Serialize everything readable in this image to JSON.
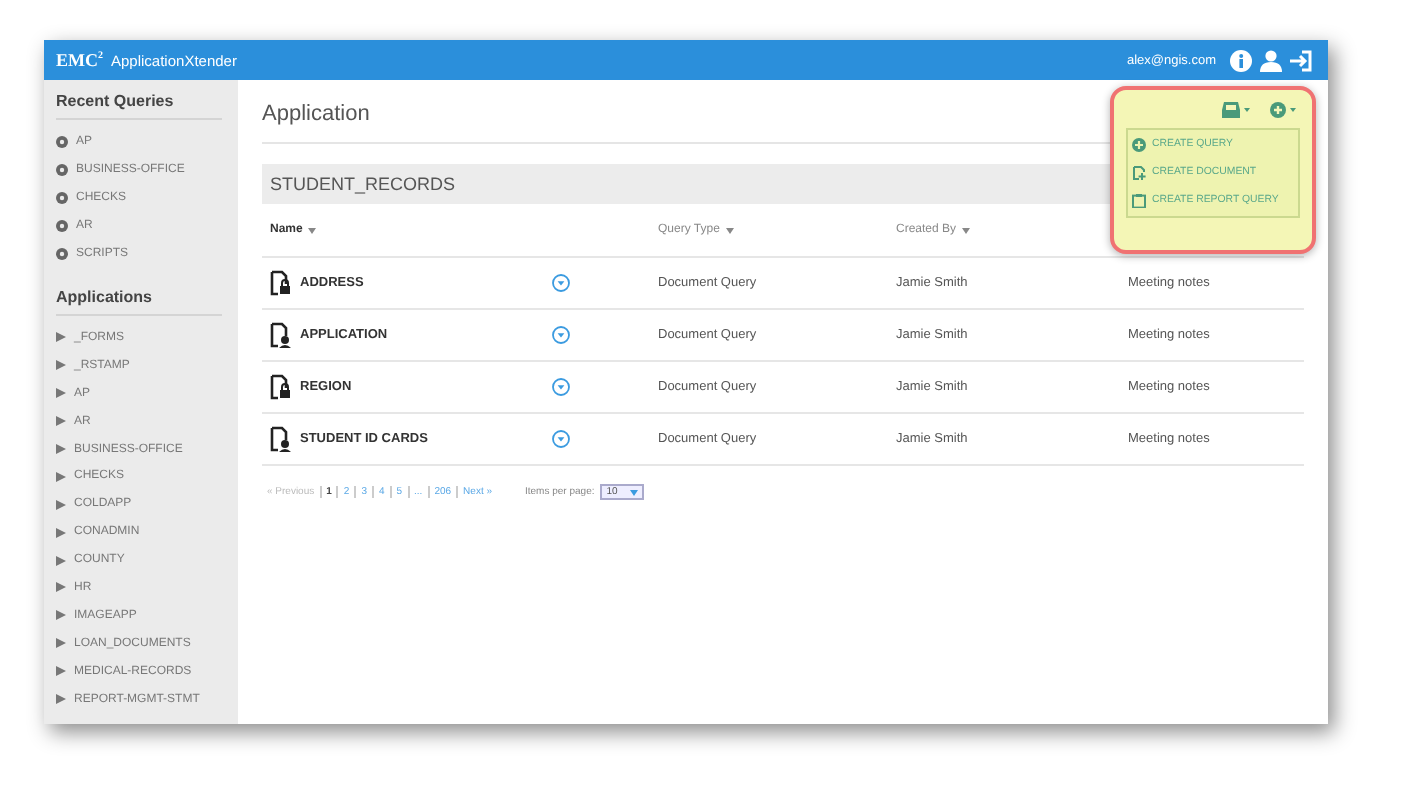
{
  "header": {
    "logo": "EMC$^{2}$",
    "product": "ApplicationXtender",
    "user": "alex@ngis.com"
  },
  "sidebar": {
    "sections": [
      {
        "title": "Recent Queries",
        "kind": "recent",
        "items": [
          "AP",
          "BUSINESS-OFFICE",
          "CHECKS",
          "AR",
          "SCRIPTS"
        ]
      },
      {
        "title": "Applications",
        "kind": "app",
        "items": [
          "_FORMS",
          "_RSTAMP",
          "AP",
          "AR",
          "BUSINESS-OFFICE",
          "CHECKS",
          "COLDAPP",
          "CONADMIN",
          "COUNTY",
          "HR",
          "IMAGEAPP",
          "LOAN_DOCUMENTS",
          "MEDICAL-RECORDS",
          "REPORT-MGMT-STMT"
        ]
      }
    ]
  },
  "page": {
    "title": "Application",
    "section": "STUDENT_RECORDS"
  },
  "table": {
    "columns": [
      "Name",
      "",
      "Query Type",
      "Created By",
      ""
    ],
    "rows": [
      {
        "name": "ADDRESS",
        "kind": "lock",
        "query_type": "Document Query",
        "created_by": "Jamie Smith",
        "column_5": "Meeting notes"
      },
      {
        "name": "APPLICATION",
        "kind": "user",
        "query_type": "Document Query",
        "created_by": "Jamie Smith",
        "column_5": "Meeting notes"
      },
      {
        "name": "REGION",
        "kind": "lock",
        "query_type": "Document Query",
        "created_by": "Jamie Smith",
        "column_5": "Meeting notes"
      },
      {
        "name": "STUDENT ID CARDS",
        "kind": "user",
        "query_type": "Document Query",
        "created_by": "Jamie Smith",
        "column_5": "Meeting notes"
      }
    ]
  },
  "pagination": {
    "previous": "« Previous",
    "items": [
      {
        "kind": "page",
        "label": "1",
        "selected": true
      },
      {
        "kind": "page",
        "label": "2",
        "selected": false
      },
      {
        "kind": "page",
        "label": "3",
        "selected": false
      },
      {
        "kind": "page",
        "label": "4",
        "selected": false
      },
      {
        "kind": "page",
        "label": "5",
        "selected": false
      },
      {
        "kind": "page",
        "label": "...",
        "selected": false
      },
      {
        "kind": "page",
        "label": "206",
        "selected": false
      }
    ],
    "next": "Next »",
    "per_page_label": "Items per page:",
    "per_page": "10"
  },
  "menu": {
    "items": [
      {
        "kind": "plus",
        "label": "CREATE QUERY"
      },
      {
        "kind": "document",
        "label": "CREATE DOCUMENT"
      },
      {
        "kind": "report",
        "label": "CREATE REPORT QUERY"
      }
    ]
  }
}
